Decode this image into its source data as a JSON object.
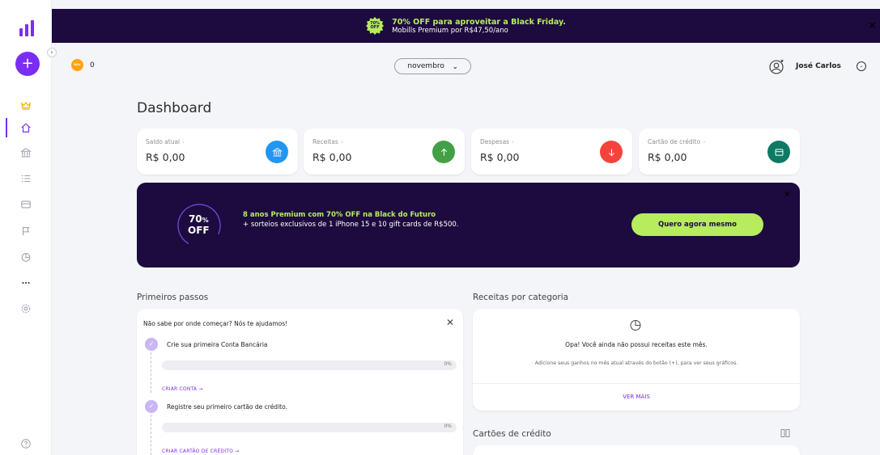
{
  "sidebar": {
    "items": [
      {
        "name": "sidebar-item-premium",
        "icon": "crown-icon"
      },
      {
        "name": "sidebar-item-home",
        "icon": "home-icon"
      },
      {
        "name": "sidebar-item-accounts",
        "icon": "bank-icon"
      },
      {
        "name": "sidebar-item-transactions",
        "icon": "list-icon"
      },
      {
        "name": "sidebar-item-cards",
        "icon": "card-icon"
      },
      {
        "name": "sidebar-item-goals",
        "icon": "flag-icon"
      },
      {
        "name": "sidebar-item-reports",
        "icon": "pie-chart-icon"
      },
      {
        "name": "sidebar-item-more",
        "icon": "more-icon"
      },
      {
        "name": "sidebar-item-settings",
        "icon": "gear-icon"
      }
    ],
    "help_icon": "help-icon",
    "accent": "#7b2cf5"
  },
  "topbar": {
    "badge": "70% OFF",
    "title": "70% OFF para aproveitar a Black Friday.",
    "subtitle": "Mobills Premium por R$47,50/ano"
  },
  "header": {
    "badge_text": "NOV",
    "count": "0",
    "month": "novembro",
    "user_name": "José Carlos"
  },
  "page": {
    "title": "Dashboard"
  },
  "cards": [
    {
      "label": "Saldo atual",
      "value": "R$ 0,00",
      "color": "#2196f3",
      "icon": "bank-icon"
    },
    {
      "label": "Receitas",
      "value": "R$ 0,00",
      "color": "#43a047",
      "icon": "arrow-up-icon"
    },
    {
      "label": "Despesas",
      "value": "R$ 0,00",
      "color": "#f4433a",
      "icon": "arrow-down-icon"
    },
    {
      "label": "Cartão de crédito",
      "value": "R$ 0,00",
      "color": "#0e7a64",
      "icon": "credit-card-icon"
    }
  ],
  "promo": {
    "ring_top": "70",
    "ring_pct": "%",
    "ring_bottom": "OFF",
    "title": "8 anos Premium com 70% OFF na Black do Futuro",
    "subtitle": "+ sorteios exclusivos de 1 iPhone 15 e 10 gift cards de R$500.",
    "cta": "Quero agora mesmo",
    "accent": "#b6ec5d",
    "background": "#1d0b3f"
  },
  "first_steps": {
    "section_title": "Primeiros passos",
    "intro": "Não sabe por onde começar? Nós te ajudamos!",
    "steps": [
      {
        "title": "Crie sua primeira Conta Bancária",
        "progress_label": "0%",
        "progress": 0,
        "link": "CRIAR CONTA"
      },
      {
        "title": "Registre seu primeiro cartão de crédito.",
        "progress_label": "0%",
        "progress": 0,
        "link": "CRIAR CARTÃO DE CRÉDITO"
      }
    ]
  },
  "category": {
    "section_title": "Receitas por categoria",
    "empty_title": "Opa! Você ainda não possui receitas este mês.",
    "empty_help": "Adicione seus ganhos no mês atual através do botão (+), para ver seus gráficos.",
    "more": "VER MAIS"
  },
  "credit_cards": {
    "section_title": "Cartões de crédito"
  }
}
